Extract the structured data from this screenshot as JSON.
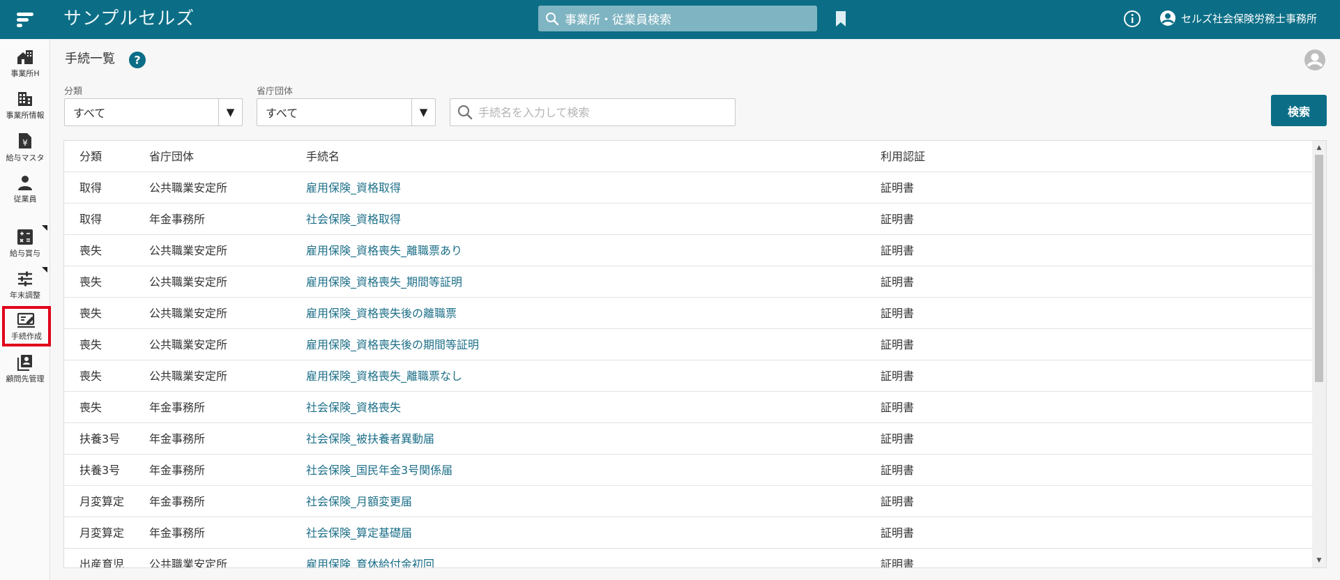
{
  "app": {
    "title": "サンプルセルズ",
    "search_placeholder": "事業所・従業員検索",
    "office_name": "セルズ社会保険労務士事務所"
  },
  "sidebar": {
    "items": [
      {
        "label": "事業所H",
        "icon": "office-home-icon"
      },
      {
        "label": "事業所情報",
        "icon": "building-icon"
      },
      {
        "label": "給与マスタ",
        "icon": "payroll-doc-icon"
      },
      {
        "label": "従業員",
        "icon": "person-icon"
      },
      {
        "label": "給与賞与",
        "icon": "calculator-icon"
      },
      {
        "label": "年末調整",
        "icon": "sliders-icon"
      },
      {
        "label": "手続作成",
        "icon": "edit-form-icon"
      },
      {
        "label": "顧問先管理",
        "icon": "contacts-icon"
      }
    ],
    "active": "手続作成"
  },
  "page": {
    "title": "手続一覧"
  },
  "filters": {
    "category_label": "分類",
    "category_value": "すべて",
    "agency_label": "省庁団体",
    "agency_value": "すべて",
    "search_placeholder": "手続名を入力して検索",
    "search_button": "検索"
  },
  "table": {
    "headers": [
      "分類",
      "省庁団体",
      "手続名",
      "利用認証"
    ],
    "rows": [
      [
        "取得",
        "公共職業安定所",
        "雇用保険_資格取得",
        "証明書"
      ],
      [
        "取得",
        "年金事務所",
        "社会保険_資格取得",
        "証明書"
      ],
      [
        "喪失",
        "公共職業安定所",
        "雇用保険_資格喪失_離職票あり",
        "証明書"
      ],
      [
        "喪失",
        "公共職業安定所",
        "雇用保険_資格喪失_期間等証明",
        "証明書"
      ],
      [
        "喪失",
        "公共職業安定所",
        "雇用保険_資格喪失後の離職票",
        "証明書"
      ],
      [
        "喪失",
        "公共職業安定所",
        "雇用保険_資格喪失後の期間等証明",
        "証明書"
      ],
      [
        "喪失",
        "公共職業安定所",
        "雇用保険_資格喪失_離職票なし",
        "証明書"
      ],
      [
        "喪失",
        "年金事務所",
        "社会保険_資格喪失",
        "証明書"
      ],
      [
        "扶養3号",
        "年金事務所",
        "社会保険_被扶養者異動届",
        "証明書"
      ],
      [
        "扶養3号",
        "年金事務所",
        "社会保険_国民年金3号関係届",
        "証明書"
      ],
      [
        "月変算定",
        "年金事務所",
        "社会保険_月額変更届",
        "証明書"
      ],
      [
        "月変算定",
        "年金事務所",
        "社会保険_算定基礎届",
        "証明書"
      ],
      [
        "出産育児",
        "公共職業安定所",
        "雇用保険_育休給付金初回",
        "証明書"
      ]
    ]
  },
  "colors": {
    "brand": "#0b6e86",
    "link": "#1d6f88",
    "active_outline": "#e0001a"
  }
}
